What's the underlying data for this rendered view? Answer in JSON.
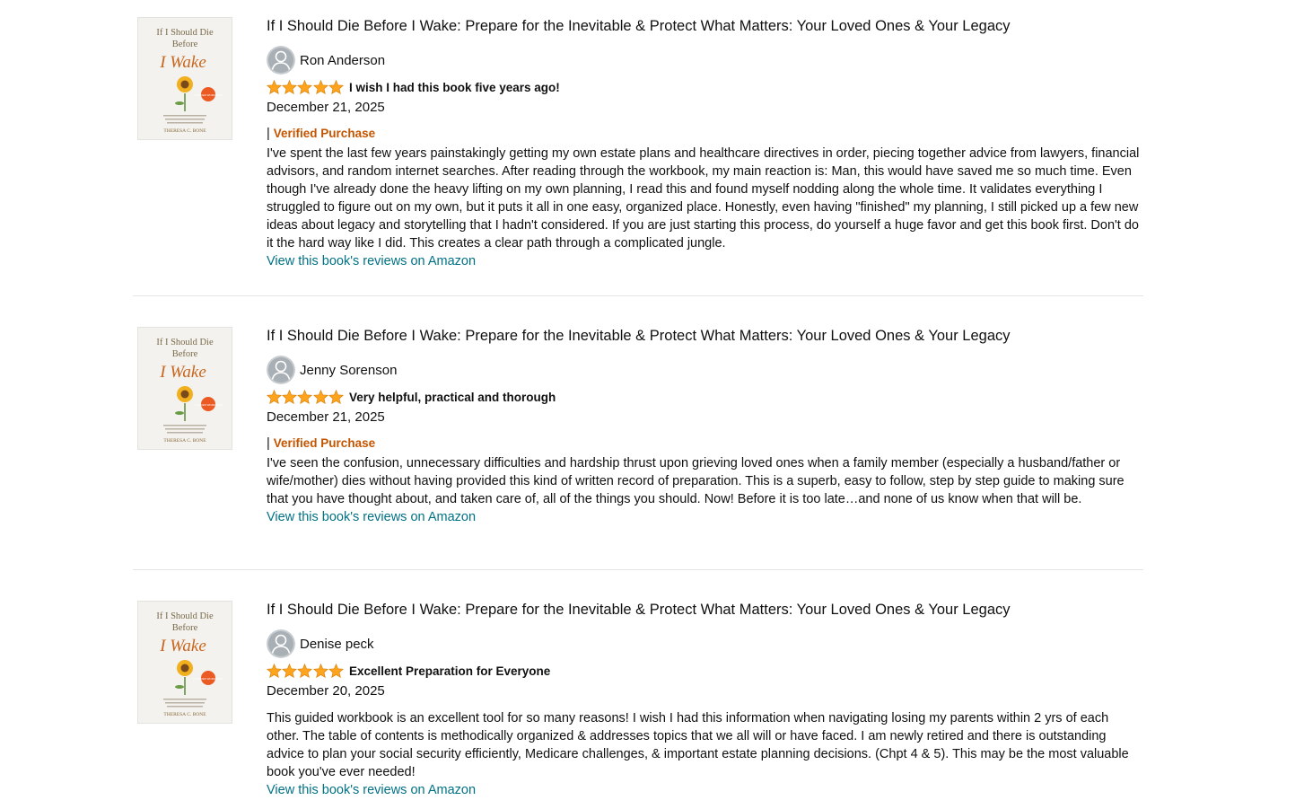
{
  "colors": {
    "accent_link": "#007185",
    "verified": "#c45500",
    "star": "#ffa41c",
    "divider": "#e3e6e6"
  },
  "reviews": [
    {
      "cover": {
        "line1": "If I Should Die",
        "line2": "Before",
        "script": "I Wake",
        "badge": "A GUIDED WORKBOOK",
        "author": "THERESA C. BONE"
      },
      "title": "If I Should Die Before I Wake: Prepare for the Inevitable & Protect What Matters: Your Loved Ones & Your Legacy",
      "reviewer": "Ron Anderson",
      "rating": 5,
      "headline": "I wish I had this book five years ago!",
      "date": "December 21, 2025",
      "verified_prefix": "|",
      "verified": "Verified Purchase",
      "text": "I've spent the last few years painstakingly getting my own estate plans and healthcare directives in order, piecing together advice from lawyers, financial advisors, and random internet searches. After reading through the workbook, my main reaction is: Man, this would have saved me so much time. Even though I've already done the heavy lifting on my own planning, I read this and found myself nodding along the whole time. It validates everything I struggled to figure out on my own, but it puts it all in one easy, organized place. Honestly, even having \"finished\" my planning, I still picked up a few new ideas about legacy and storytelling that I hadn't considered. If you are just starting this process, do yourself a huge favor and get this book first. Don't do it the hard way like I did. This creates a clear path through a complicated jungle.",
      "link": "View this book's reviews on Amazon"
    },
    {
      "cover": {
        "line1": "If I Should Die",
        "line2": "Before",
        "script": "I Wake",
        "badge": "A GUIDED WORKBOOK",
        "author": "THERESA C. BONE"
      },
      "title": "If I Should Die Before I Wake: Prepare for the Inevitable & Protect What Matters: Your Loved Ones & Your Legacy",
      "reviewer": "Jenny Sorenson",
      "rating": 5,
      "headline": "Very helpful, practical and thorough",
      "date": "December 21, 2025",
      "verified_prefix": "|",
      "verified": "Verified Purchase",
      "text": "I've seen the confusion, unnecessary difficulties and hardship thrust upon grieving loved ones when a family member (especially a husband/father or wife/mother) dies without having provided this kind of written record of preparation. This is a superb, easy to follow, step by step guide to making sure that you have thought about, and taken care of, all of the things you should. Now! Before it is too late…and none of us know when that will be.",
      "link": "View this book's reviews on Amazon"
    },
    {
      "cover": {
        "line1": "If I Should Die",
        "line2": "Before",
        "script": "I Wake",
        "badge": "A GUIDED WORKBOOK",
        "author": "THERESA C. BONE"
      },
      "title": "If I Should Die Before I Wake: Prepare for the Inevitable & Protect What Matters: Your Loved Ones & Your Legacy",
      "reviewer": "Denise peck",
      "rating": 5,
      "headline": "Excellent Preparation for Everyone",
      "date": "December 20, 2025",
      "verified_prefix": "",
      "verified": "",
      "text": "This guided workbook is an excellent tool for so many reasons! I wish I had this information when navigating losing my parents within 2 yrs of each other. The table of contents is methodically organized & addresses topics that we all will or have faced. I am newly retired and there is outstanding advice to plan your social security efficiently, Medicare challenges, & important estate planning decisions. (Chpt 4 & 5). This may be the most valuable book you've ever needed!",
      "link": "View this book's reviews on Amazon"
    }
  ]
}
